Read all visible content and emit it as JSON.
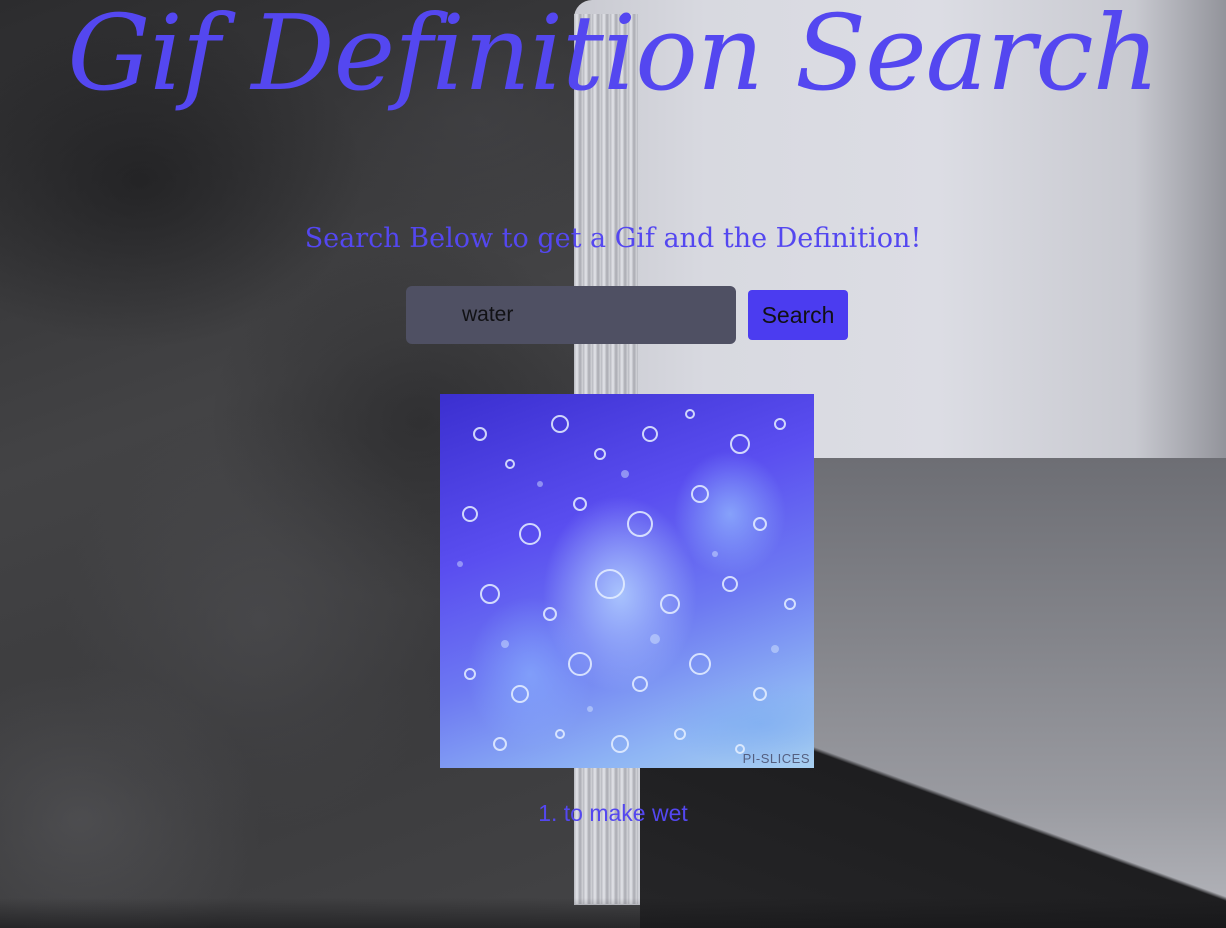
{
  "page": {
    "title": "Gif Definition Search",
    "subtitle": "Search Below to get a Gif and the Definition!"
  },
  "search": {
    "value": "water",
    "button_label": "Search"
  },
  "result": {
    "gif_watermark": "PI-SLICES",
    "definition": "1. to make wet"
  },
  "colors": {
    "accent": "#5447f0",
    "button": "#4b3cf0",
    "input_bg": "#4f5063"
  }
}
